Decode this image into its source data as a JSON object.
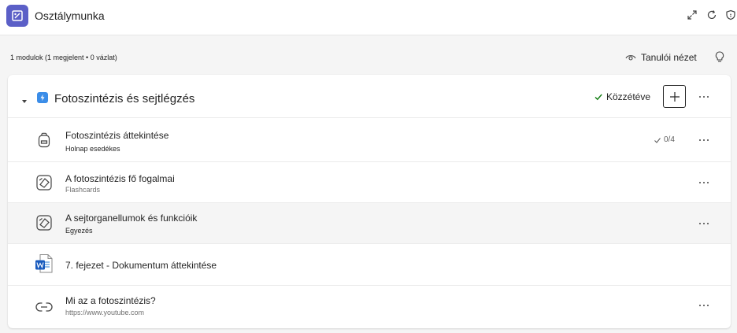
{
  "app": {
    "title": "Osztálymunka",
    "accent": "#5b5fc7"
  },
  "header_icons": [
    "expand-icon",
    "refresh-icon",
    "shield-icon"
  ],
  "toolbar": {
    "summary": "1 modulok (1 megjelent • 0 vázlat)",
    "student_view_label": "Tanulói nézet"
  },
  "module": {
    "title": "Fotoszintézis és sejtlégzés",
    "status_label": "Közzétéve",
    "icon_color": "#3b8de8",
    "items": [
      {
        "title": "Fotoszintézis áttekintése",
        "subtitle": "Holnap esedékes",
        "count": "0/4",
        "icon": "backpack-icon"
      },
      {
        "title": "A fotoszintézis fő fogalmai",
        "subtitle": "Flashcards",
        "icon": "flashcards-icon"
      },
      {
        "title": "A sejtorganellumok és funkcióik",
        "subtitle": "Egyezés",
        "icon": "flashcards-icon"
      },
      {
        "title": "7. fejezet - Dokumentum áttekintése",
        "icon": "word-document-icon"
      },
      {
        "title": "Mi az a fotoszintézis?",
        "subtitle": "https://www.youtube.com",
        "icon": "link-icon"
      }
    ]
  }
}
